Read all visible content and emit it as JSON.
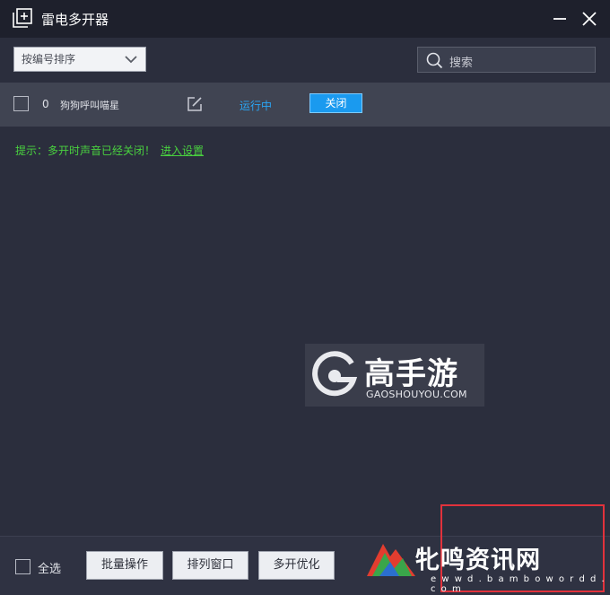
{
  "window": {
    "title": "雷电多开器",
    "controls": [
      "minimize-icon",
      "close-icon"
    ]
  },
  "toolbar": {
    "sort_select": {
      "value": "按编号排序"
    },
    "search": {
      "placeholder": "搜索"
    }
  },
  "instances": [
    {
      "index": "0",
      "name": "狗狗呼叫喵星",
      "status": "运行中",
      "action_label": "关闭",
      "checked": false
    }
  ],
  "hint": {
    "text": "提示：多开时声音已经关闭！",
    "link": "进入设置"
  },
  "watermark": {
    "brand_cn": "高手游",
    "brand_en": "GAOSHOUYOU.COM"
  },
  "bottombar": {
    "select_all_label": "全选",
    "buttons": [
      "批量操作",
      "排列窗口",
      "多开优化"
    ]
  },
  "overlay_watermark": {
    "text": "牝鸣资讯网",
    "sub": "e w w d . b a m b o w o r d d . c o m"
  },
  "colors": {
    "background": "#2b2e3d",
    "titlebar": "#1e202c",
    "row": "#404452",
    "accent": "#1a9aef",
    "status": "#2aa6f5",
    "hint": "#49d13f",
    "highlight": "#e2323c"
  }
}
